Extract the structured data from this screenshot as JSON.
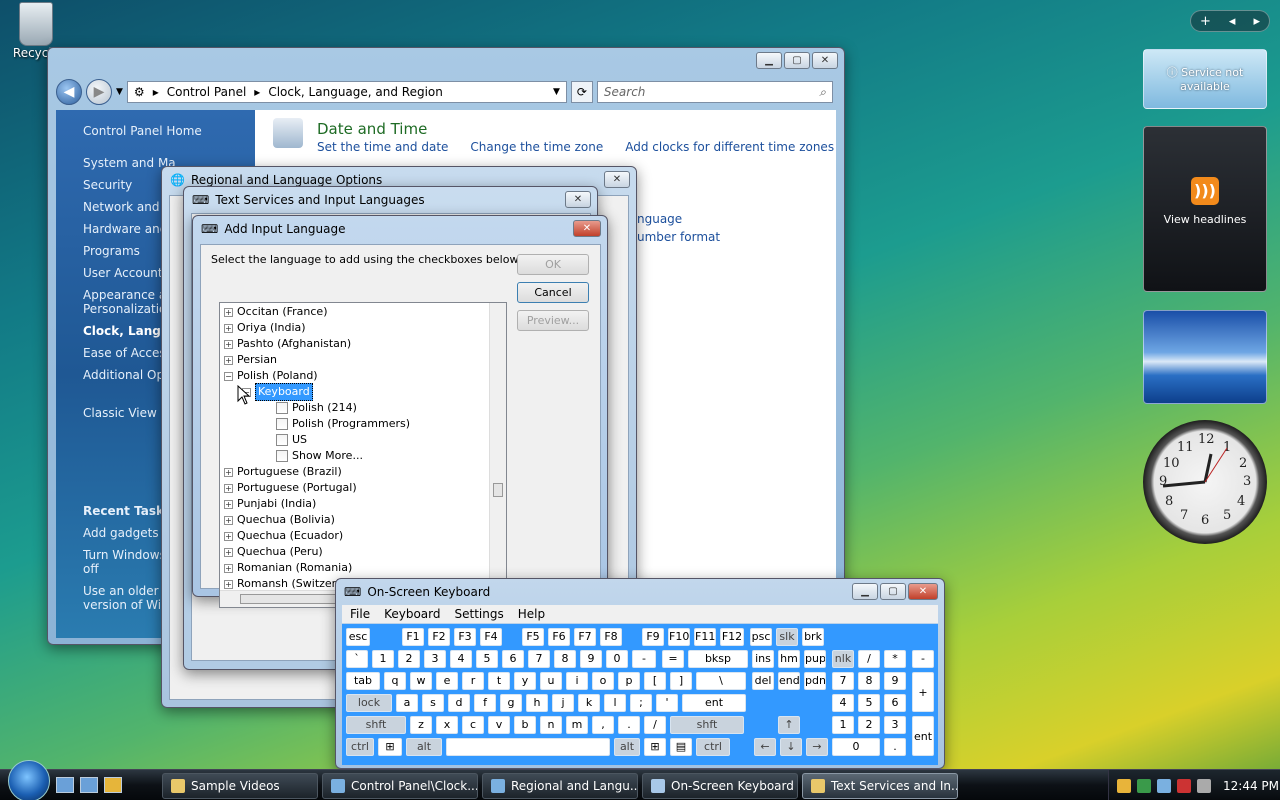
{
  "desktop": {
    "recycle_bin_label": "Recycle"
  },
  "sidebar": {
    "toolbar": {
      "add": "+",
      "prev": "◂",
      "next": "▸"
    },
    "weather": {
      "text": "Service not available"
    },
    "feed": {
      "label": "View headlines"
    },
    "clock_numbers": [
      "12",
      "1",
      "2",
      "3",
      "4",
      "5",
      "6",
      "7",
      "8",
      "9",
      "10",
      "11"
    ]
  },
  "control_panel": {
    "address": {
      "root": "Control Panel",
      "current": "Clock, Language, and Region"
    },
    "search_placeholder": "Search",
    "left_links": [
      "Control Panel Home",
      "System and Ma",
      "Security",
      "Network and In",
      "Hardware and",
      "Programs",
      "User Accounts",
      "Appearance an",
      "Personalizatio",
      "Clock, Languag",
      "Ease of Access",
      "Additional Opt",
      "Classic View"
    ],
    "recent_tasks": {
      "heading": "Recent Tasks",
      "items": [
        "Add gadgets to",
        "Turn Windows",
        "off",
        "Use an older p",
        "version of Win"
      ]
    },
    "main": {
      "date_time_title": "Date and Time",
      "date_time_links": [
        "Set the time and date",
        "Change the time zone",
        "Add clocks for different time zones"
      ],
      "partial_links": [
        "nguage",
        "umber format"
      ]
    }
  },
  "regional_dialog": {
    "title": "Regional and Language Options"
  },
  "text_services_dialog": {
    "title": "Text Services and Input Languages"
  },
  "add_input_dialog": {
    "title": "Add Input Language",
    "instruction": "Select the language to add using the checkboxes below.",
    "ok": "OK",
    "cancel": "Cancel",
    "preview": "Preview...",
    "tree": [
      "Occitan (France)",
      "Oriya (India)",
      "Pashto (Afghanistan)",
      "Persian",
      "Polish (Poland)",
      "Keyboard",
      "Polish (214)",
      "Polish (Programmers)",
      "US",
      "Show More...",
      "Portuguese (Brazil)",
      "Portuguese (Portugal)",
      "Punjabi (India)",
      "Quechua (Bolivia)",
      "Quechua (Ecuador)",
      "Quechua (Peru)",
      "Romanian (Romania)",
      "Romansh (Switzerland)"
    ]
  },
  "osk": {
    "title": "On-Screen Keyboard",
    "menu": [
      "File",
      "Keyboard",
      "Settings",
      "Help"
    ],
    "row1": [
      "esc",
      "F1",
      "F2",
      "F3",
      "F4",
      "F5",
      "F6",
      "F7",
      "F8",
      "F9",
      "F10",
      "F11",
      "F12",
      "psc",
      "slk",
      "brk"
    ],
    "row2": [
      "`",
      "1",
      "2",
      "3",
      "4",
      "5",
      "6",
      "7",
      "8",
      "9",
      "0",
      "-",
      "=",
      "bksp",
      "ins",
      "hm",
      "pup",
      "nlk",
      "/",
      "*",
      "-"
    ],
    "row3": [
      "tab",
      "q",
      "w",
      "e",
      "r",
      "t",
      "y",
      "u",
      "i",
      "o",
      "p",
      "[",
      "]",
      "\\",
      "del",
      "end",
      "pdn",
      "7",
      "8",
      "9",
      "+"
    ],
    "row4": [
      "lock",
      "a",
      "s",
      "d",
      "f",
      "g",
      "h",
      "j",
      "k",
      "l",
      ";",
      "'",
      "ent",
      "4",
      "5",
      "6"
    ],
    "row5": [
      "shft",
      "z",
      "x",
      "c",
      "v",
      "b",
      "n",
      "m",
      ",",
      ".",
      "/",
      "shft",
      "↑",
      "1",
      "2",
      "3",
      "ent"
    ],
    "row6": [
      "ctrl",
      "⊞",
      "alt",
      "",
      "alt",
      "⊞",
      "▤",
      "ctrl",
      "←",
      "↓",
      "→",
      "0",
      "."
    ]
  },
  "taskbar": {
    "buttons": [
      "Sample Videos",
      "Control Panel\\Clock...",
      "Regional and Langu...",
      "On-Screen Keyboard",
      "Text Services and In..."
    ],
    "time": "12:44 PM"
  }
}
